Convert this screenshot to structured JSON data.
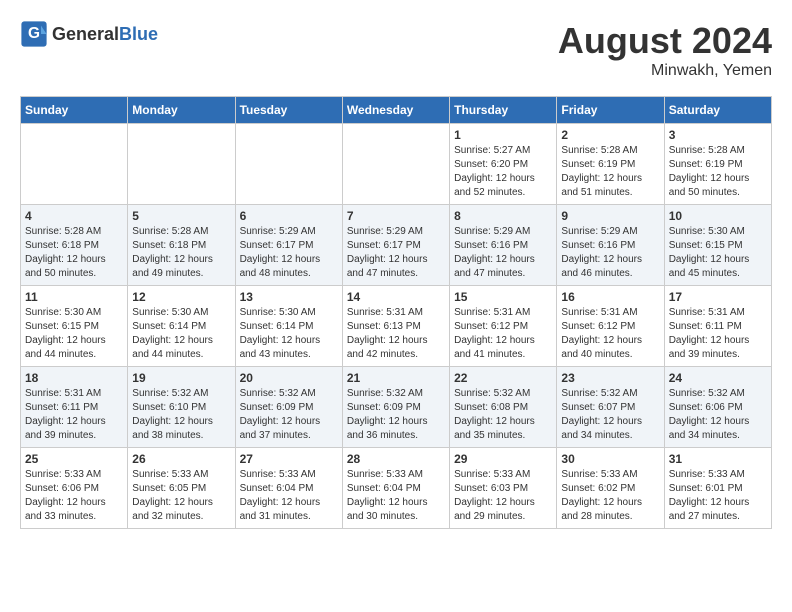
{
  "header": {
    "logo_general": "General",
    "logo_blue": "Blue",
    "month_year": "August 2024",
    "location": "Minwakh, Yemen"
  },
  "days_of_week": [
    "Sunday",
    "Monday",
    "Tuesday",
    "Wednesday",
    "Thursday",
    "Friday",
    "Saturday"
  ],
  "weeks": [
    [
      {
        "day": "",
        "content": ""
      },
      {
        "day": "",
        "content": ""
      },
      {
        "day": "",
        "content": ""
      },
      {
        "day": "",
        "content": ""
      },
      {
        "day": "1",
        "content": "Sunrise: 5:27 AM\nSunset: 6:20 PM\nDaylight: 12 hours\nand 52 minutes."
      },
      {
        "day": "2",
        "content": "Sunrise: 5:28 AM\nSunset: 6:19 PM\nDaylight: 12 hours\nand 51 minutes."
      },
      {
        "day": "3",
        "content": "Sunrise: 5:28 AM\nSunset: 6:19 PM\nDaylight: 12 hours\nand 50 minutes."
      }
    ],
    [
      {
        "day": "4",
        "content": "Sunrise: 5:28 AM\nSunset: 6:18 PM\nDaylight: 12 hours\nand 50 minutes."
      },
      {
        "day": "5",
        "content": "Sunrise: 5:28 AM\nSunset: 6:18 PM\nDaylight: 12 hours\nand 49 minutes."
      },
      {
        "day": "6",
        "content": "Sunrise: 5:29 AM\nSunset: 6:17 PM\nDaylight: 12 hours\nand 48 minutes."
      },
      {
        "day": "7",
        "content": "Sunrise: 5:29 AM\nSunset: 6:17 PM\nDaylight: 12 hours\nand 47 minutes."
      },
      {
        "day": "8",
        "content": "Sunrise: 5:29 AM\nSunset: 6:16 PM\nDaylight: 12 hours\nand 47 minutes."
      },
      {
        "day": "9",
        "content": "Sunrise: 5:29 AM\nSunset: 6:16 PM\nDaylight: 12 hours\nand 46 minutes."
      },
      {
        "day": "10",
        "content": "Sunrise: 5:30 AM\nSunset: 6:15 PM\nDaylight: 12 hours\nand 45 minutes."
      }
    ],
    [
      {
        "day": "11",
        "content": "Sunrise: 5:30 AM\nSunset: 6:15 PM\nDaylight: 12 hours\nand 44 minutes."
      },
      {
        "day": "12",
        "content": "Sunrise: 5:30 AM\nSunset: 6:14 PM\nDaylight: 12 hours\nand 44 minutes."
      },
      {
        "day": "13",
        "content": "Sunrise: 5:30 AM\nSunset: 6:14 PM\nDaylight: 12 hours\nand 43 minutes."
      },
      {
        "day": "14",
        "content": "Sunrise: 5:31 AM\nSunset: 6:13 PM\nDaylight: 12 hours\nand 42 minutes."
      },
      {
        "day": "15",
        "content": "Sunrise: 5:31 AM\nSunset: 6:12 PM\nDaylight: 12 hours\nand 41 minutes."
      },
      {
        "day": "16",
        "content": "Sunrise: 5:31 AM\nSunset: 6:12 PM\nDaylight: 12 hours\nand 40 minutes."
      },
      {
        "day": "17",
        "content": "Sunrise: 5:31 AM\nSunset: 6:11 PM\nDaylight: 12 hours\nand 39 minutes."
      }
    ],
    [
      {
        "day": "18",
        "content": "Sunrise: 5:31 AM\nSunset: 6:11 PM\nDaylight: 12 hours\nand 39 minutes."
      },
      {
        "day": "19",
        "content": "Sunrise: 5:32 AM\nSunset: 6:10 PM\nDaylight: 12 hours\nand 38 minutes."
      },
      {
        "day": "20",
        "content": "Sunrise: 5:32 AM\nSunset: 6:09 PM\nDaylight: 12 hours\nand 37 minutes."
      },
      {
        "day": "21",
        "content": "Sunrise: 5:32 AM\nSunset: 6:09 PM\nDaylight: 12 hours\nand 36 minutes."
      },
      {
        "day": "22",
        "content": "Sunrise: 5:32 AM\nSunset: 6:08 PM\nDaylight: 12 hours\nand 35 minutes."
      },
      {
        "day": "23",
        "content": "Sunrise: 5:32 AM\nSunset: 6:07 PM\nDaylight: 12 hours\nand 34 minutes."
      },
      {
        "day": "24",
        "content": "Sunrise: 5:32 AM\nSunset: 6:06 PM\nDaylight: 12 hours\nand 34 minutes."
      }
    ],
    [
      {
        "day": "25",
        "content": "Sunrise: 5:33 AM\nSunset: 6:06 PM\nDaylight: 12 hours\nand 33 minutes."
      },
      {
        "day": "26",
        "content": "Sunrise: 5:33 AM\nSunset: 6:05 PM\nDaylight: 12 hours\nand 32 minutes."
      },
      {
        "day": "27",
        "content": "Sunrise: 5:33 AM\nSunset: 6:04 PM\nDaylight: 12 hours\nand 31 minutes."
      },
      {
        "day": "28",
        "content": "Sunrise: 5:33 AM\nSunset: 6:04 PM\nDaylight: 12 hours\nand 30 minutes."
      },
      {
        "day": "29",
        "content": "Sunrise: 5:33 AM\nSunset: 6:03 PM\nDaylight: 12 hours\nand 29 minutes."
      },
      {
        "day": "30",
        "content": "Sunrise: 5:33 AM\nSunset: 6:02 PM\nDaylight: 12 hours\nand 28 minutes."
      },
      {
        "day": "31",
        "content": "Sunrise: 5:33 AM\nSunset: 6:01 PM\nDaylight: 12 hours\nand 27 minutes."
      }
    ]
  ]
}
